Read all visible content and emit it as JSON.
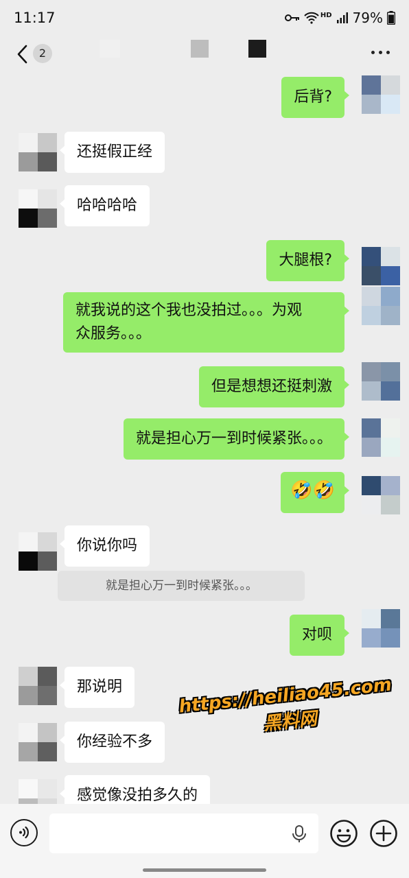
{
  "status_bar": {
    "time": "11:17",
    "network": "HD",
    "battery": "79%"
  },
  "header": {
    "unread_count": "2"
  },
  "messages": [
    {
      "side": "out",
      "text": "后背?"
    },
    {
      "side": "in",
      "text": "还挺假正经"
    },
    {
      "side": "in",
      "text": "哈哈哈哈"
    },
    {
      "side": "out",
      "text": "大腿根?"
    },
    {
      "side": "out",
      "line1": "就我说的这个我也没拍过。。。为观",
      "line2": "众服务。。。"
    },
    {
      "side": "out",
      "text": "但是想想还挺刺激"
    },
    {
      "side": "out",
      "text": "就是担心万一到时候紧张。。。"
    },
    {
      "side": "out",
      "text": "🤣🤣"
    },
    {
      "side": "in",
      "text": "你说你吗"
    },
    {
      "side": "quote",
      "text": "就是担心万一到时候紧张。。。"
    },
    {
      "side": "out",
      "text": "对呗"
    },
    {
      "side": "in",
      "text": "那说明"
    },
    {
      "side": "in",
      "text": "你经验不多"
    },
    {
      "side": "in",
      "text": "感觉像没拍多久的"
    }
  ],
  "watermark": {
    "url": "https://heiliao45.com",
    "name": "黑料网"
  },
  "icons": [
    "back-icon",
    "more-icon",
    "voice-icon",
    "mic-icon",
    "emoji-icon",
    "plus-icon"
  ],
  "colors": {
    "outgoing_bubble": "#95ec69",
    "incoming_bubble": "#ffffff",
    "chat_background": "#ededed"
  }
}
